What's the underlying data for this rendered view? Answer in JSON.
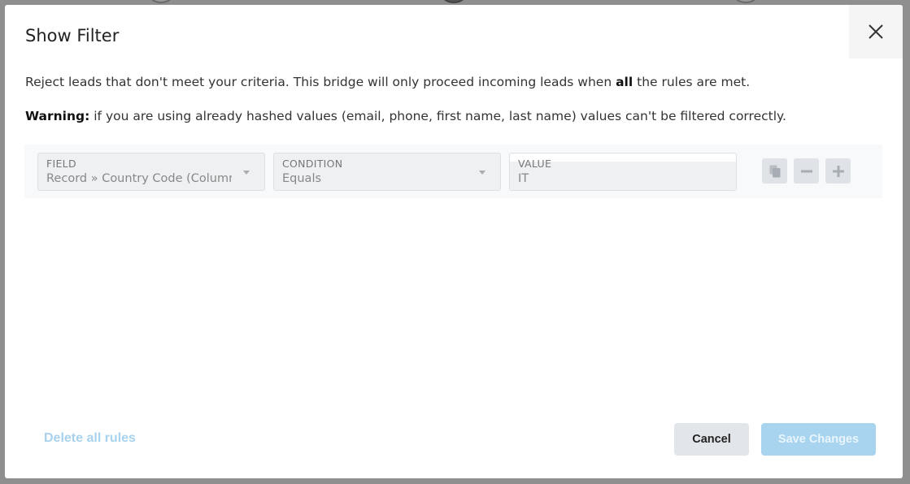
{
  "modal": {
    "title": "Show Filter",
    "description_pre": "Reject leads that don't meet your criteria. This bridge will only proceed incoming leads when ",
    "description_bold": "all",
    "description_post": " the rules are met.",
    "warning_label": "Warning:",
    "warning_text": " if you are using already hashed values (email, phone, first name, last name) values can't be filtered correctly."
  },
  "rule": {
    "field_label": "FIELD",
    "field_value": "Record » Country Code (Column #",
    "condition_label": "CONDITION",
    "condition_value": "Equals",
    "value_label": "VALUE",
    "value_value": "IT"
  },
  "icons": {
    "close": "close-icon",
    "copy": "copy-icon",
    "remove": "minus-icon",
    "add": "plus-icon",
    "caret": "chevron-down-icon"
  },
  "footer": {
    "delete_all": "Delete all rules",
    "cancel": "Cancel",
    "save": "Save Changes"
  },
  "colors": {
    "accent_light": "#a9d4ef",
    "overlay": "#8f8f8f"
  }
}
